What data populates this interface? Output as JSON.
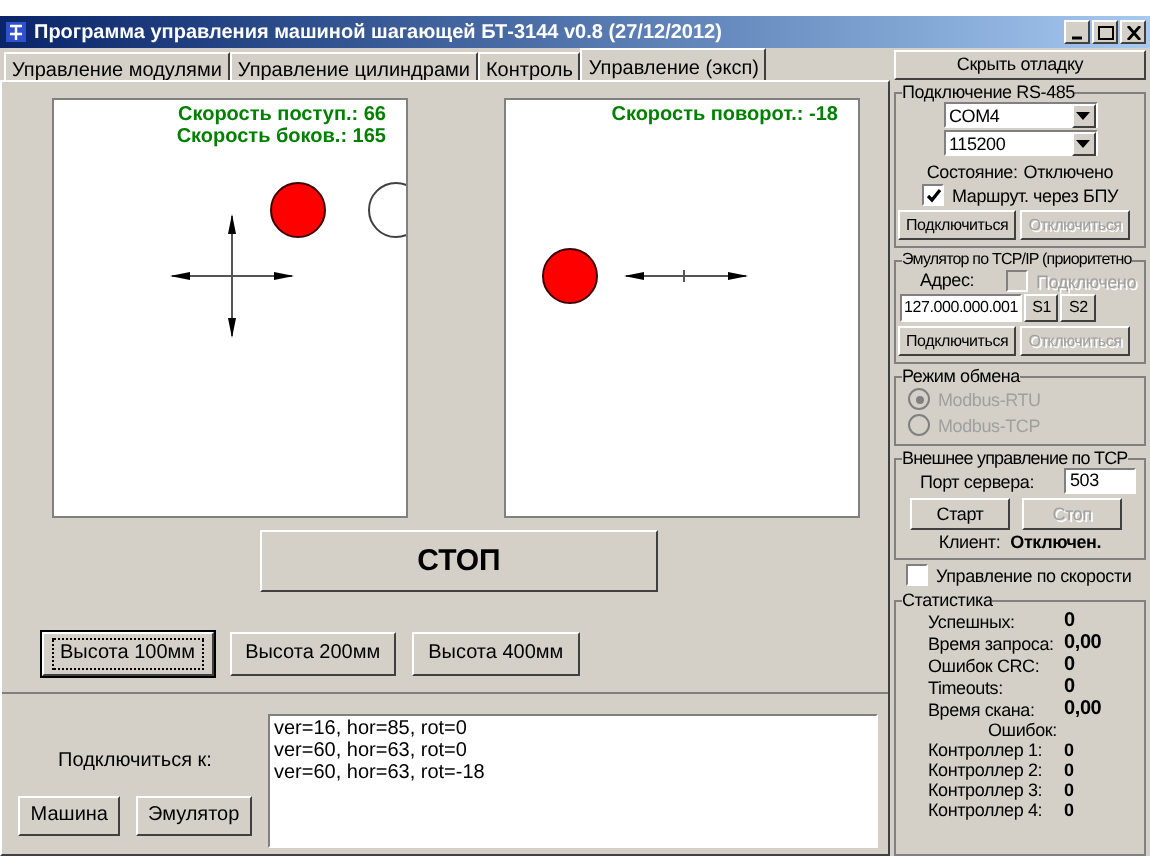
{
  "window": {
    "title": "Программа управления машиной шагающей БТ-3144 v0.8 (27/12/2012)"
  },
  "tabs": [
    {
      "label": "Управление модулями",
      "selected": false
    },
    {
      "label": "Управление цилиндрами",
      "selected": false
    },
    {
      "label": "Контроль",
      "selected": false
    },
    {
      "label": "Управление (эксп)",
      "selected": true
    }
  ],
  "canvases": [
    {
      "kind": "cross",
      "labels": [
        "Скорость поступ.: 66",
        "Скорость боков.: 165"
      ]
    },
    {
      "kind": "rotation",
      "labels": [
        "Скорость поворот.: -18"
      ]
    }
  ],
  "stop_button": "СТОП",
  "height_buttons": [
    {
      "label": "Высота 100мм",
      "focused": true
    },
    {
      "label": "Высота 200мм",
      "focused": false
    },
    {
      "label": "Высота 400мм",
      "focused": false
    }
  ],
  "connect_to": {
    "label": "Подключиться к:",
    "buttons": [
      "Машина",
      "Эмулятор"
    ]
  },
  "log": [
    "ver=16, hor=85, rot=0",
    "ver=60, hor=63, rot=0",
    "ver=60, hor=63, rot=-18"
  ],
  "debug_button": "Скрыть отладку",
  "rs485": {
    "title": "Подключение RS-485",
    "port": "COM4",
    "baud": "115200",
    "state_label": "Состояние:",
    "state_value": "Отключено",
    "route": {
      "label": "Маршрут. через БПУ",
      "checked": true
    },
    "connect": {
      "label": "Подключиться",
      "disabled": false
    },
    "disconnect": {
      "label": "Отключиться",
      "disabled": true
    }
  },
  "tcp_emulator": {
    "title": "Эмулятор по TCP/IP (приоритетно",
    "address_label": "Адрес:",
    "connected": {
      "label": "Подключено",
      "checked": false,
      "disabled": true
    },
    "address": "127.000.000.001",
    "s_buttons": [
      "S1",
      "S2"
    ],
    "connect": {
      "label": "Подключиться",
      "disabled": false
    },
    "disconnect": {
      "label": "Отключиться",
      "disabled": true
    }
  },
  "exchange_mode": {
    "title": "Режим обмена",
    "options": [
      {
        "label": "Modbus-RTU",
        "selected": true,
        "disabled": true
      },
      {
        "label": "Modbus-TCP",
        "selected": false,
        "disabled": true
      }
    ]
  },
  "external_tcp": {
    "title": "Внешнее управление по TCP",
    "port_label": "Порт сервера:",
    "port": "503",
    "start": {
      "label": "Старт",
      "disabled": false
    },
    "stop": {
      "label": "Стоп",
      "disabled": true
    },
    "client_label": "Клиент:",
    "client_value": "Отключен."
  },
  "speed_control": {
    "label": "Управление по скорости",
    "checked": false
  },
  "stats": {
    "title": "Статистика",
    "rows": [
      {
        "label": "Успешных:",
        "value": "0"
      },
      {
        "label": "Время запроса:",
        "value": "0,00"
      },
      {
        "label": "Ошибок CRC:",
        "value": "0"
      },
      {
        "label": "Timeouts:",
        "value": "0"
      },
      {
        "label": "Время скана:",
        "value": "0,00"
      }
    ],
    "errors_label": "Ошибок:",
    "controllers": [
      {
        "label": "Контроллер 1:",
        "value": "0"
      },
      {
        "label": "Контроллер 2:",
        "value": "0"
      },
      {
        "label": "Контроллер 3:",
        "value": "0"
      },
      {
        "label": "Контроллер 4:",
        "value": "0"
      }
    ]
  }
}
